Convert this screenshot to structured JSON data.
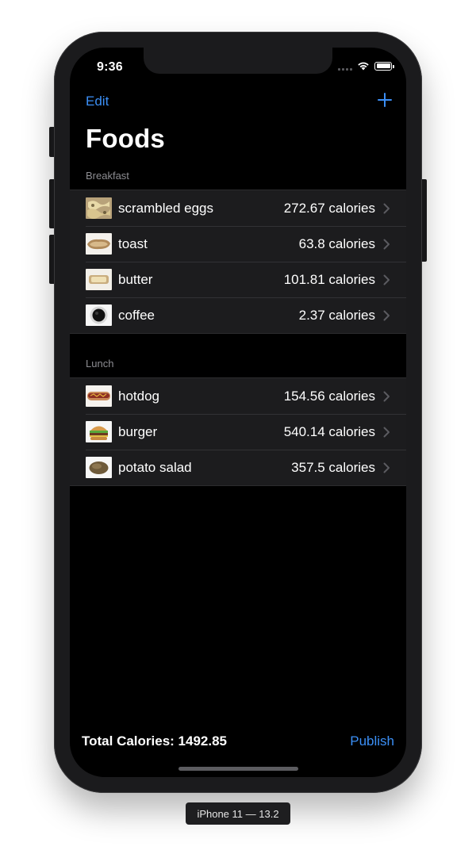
{
  "status_bar": {
    "time": "9:36"
  },
  "nav": {
    "edit_label": "Edit",
    "add_icon": "plus-icon"
  },
  "page": {
    "title": "Foods"
  },
  "sections": [
    {
      "header": "Breakfast",
      "items": [
        {
          "name": "scrambled eggs",
          "calories": "272.67 calories",
          "thumbnail": "scrambled-eggs-image"
        },
        {
          "name": "toast",
          "calories": "63.8 calories",
          "thumbnail": "toast-image"
        },
        {
          "name": "butter",
          "calories": "101.81 calories",
          "thumbnail": "butter-image"
        },
        {
          "name": "coffee",
          "calories": "2.37 calories",
          "thumbnail": "coffee-image"
        }
      ]
    },
    {
      "header": "Lunch",
      "items": [
        {
          "name": "hotdog",
          "calories": "154.56 calories",
          "thumbnail": "hotdog-image"
        },
        {
          "name": "burger",
          "calories": "540.14 calories",
          "thumbnail": "burger-image"
        },
        {
          "name": "potato salad",
          "calories": "357.5 calories",
          "thumbnail": "potato-salad-image"
        }
      ]
    }
  ],
  "footer": {
    "total_label": "Total Calories: 1492.85",
    "publish_label": "Publish"
  },
  "device_label": "iPhone 11 — 13.2",
  "colors": {
    "accent": "#3b8ff6",
    "background": "#000000",
    "cell": "#1c1c1e",
    "section_header": "#8d8d92"
  }
}
